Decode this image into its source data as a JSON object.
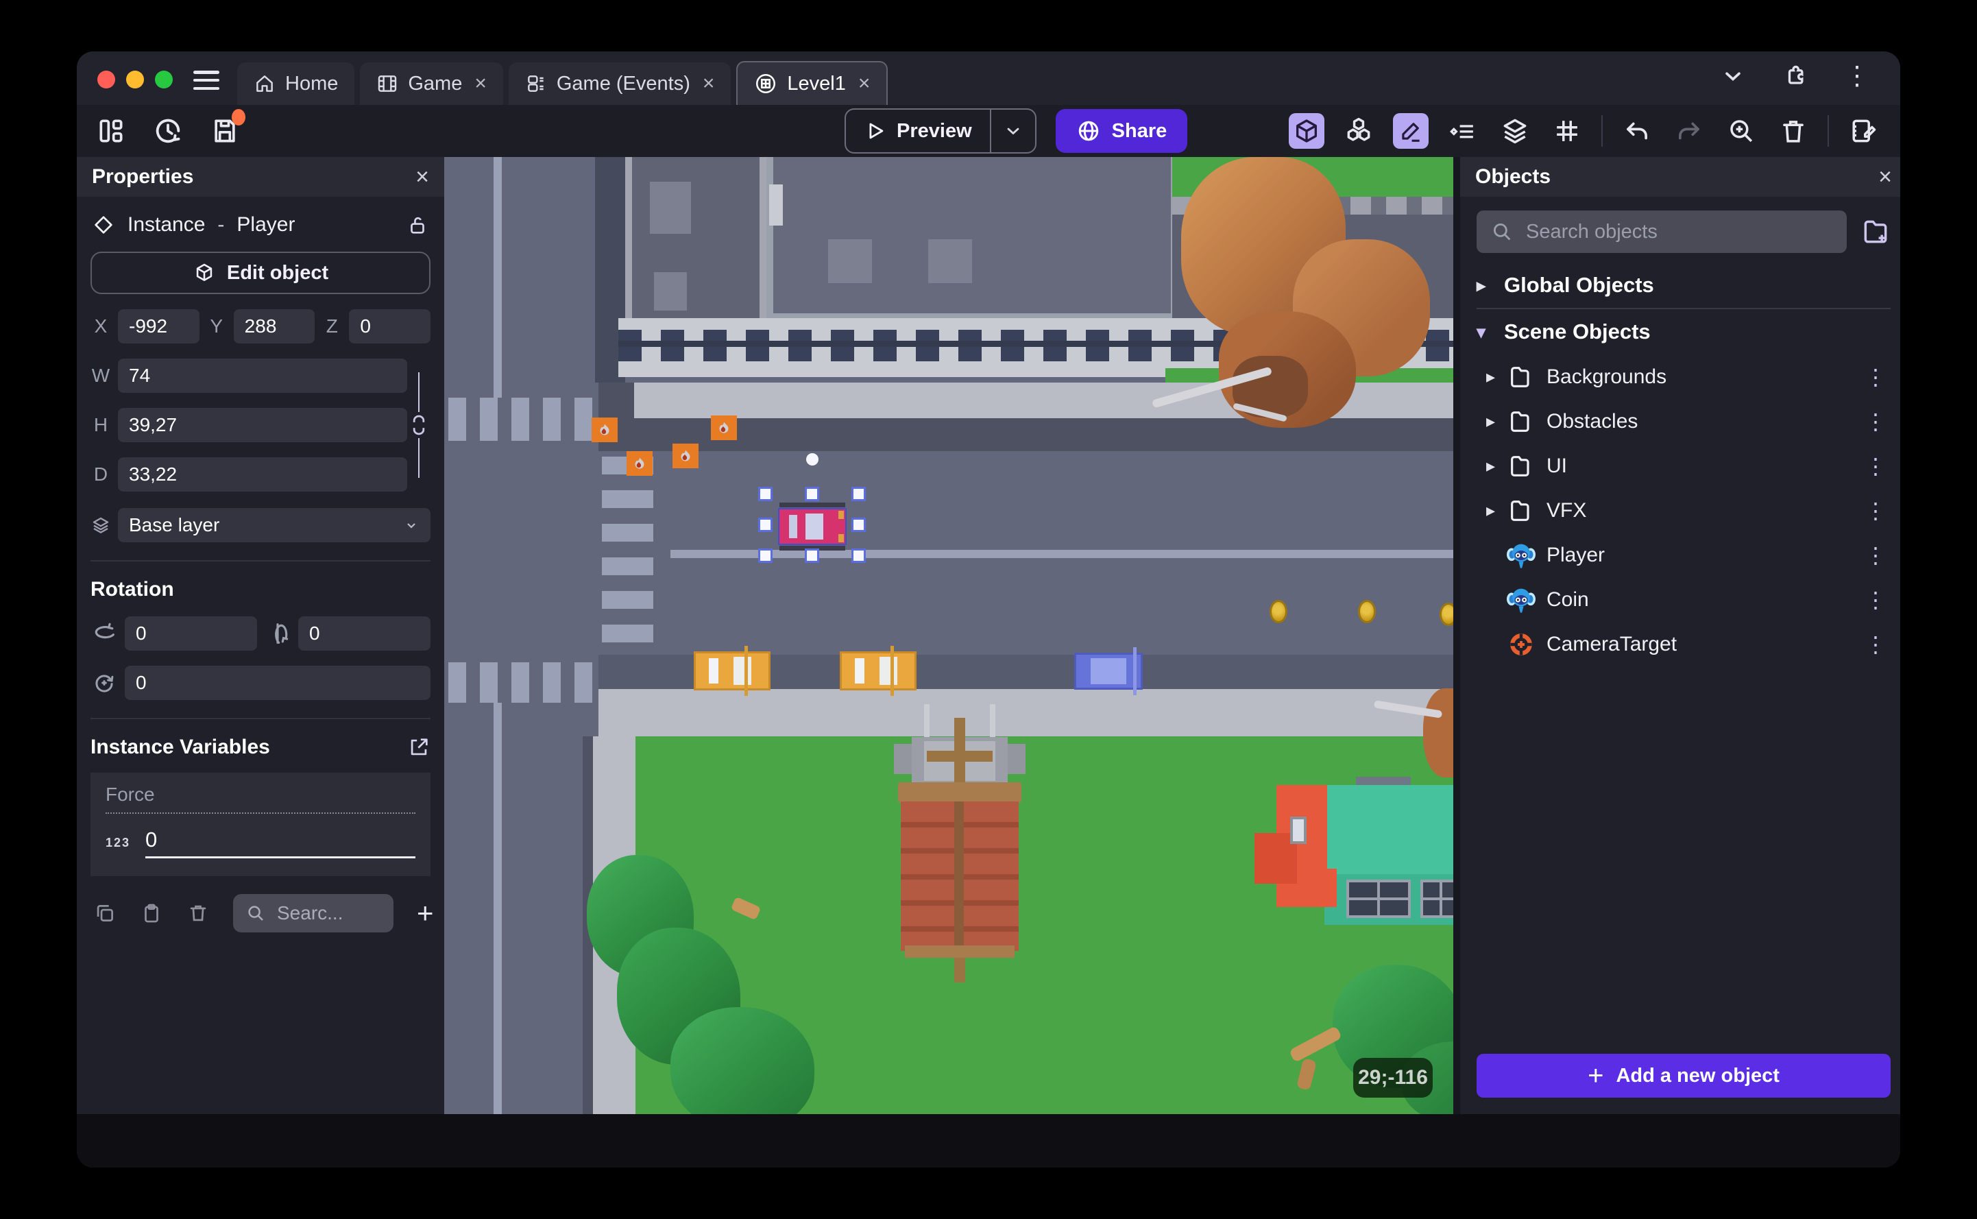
{
  "tabs": {
    "items": [
      {
        "label": "Home"
      },
      {
        "label": "Game"
      },
      {
        "label": "Game (Events)"
      },
      {
        "label": "Level1"
      }
    ],
    "close_glyph": "×"
  },
  "toolbar": {
    "preview": "Preview",
    "share": "Share"
  },
  "properties": {
    "title": "Properties",
    "close_glyph": "×",
    "instance_word": "Instance",
    "dash": "-",
    "object_name": "Player",
    "edit_object": "Edit object",
    "x_label": "X",
    "x_value": "-992",
    "y_label": "Y",
    "y_value": "288",
    "z_label": "Z",
    "z_value": "0",
    "w_label": "W",
    "w_value": "74",
    "h_label": "H",
    "h_value": "39,27",
    "d_label": "D",
    "d_value": "33,22",
    "layer_value": "Base layer",
    "rotation_title": "Rotation",
    "rot_x": "0",
    "rot_y": "0",
    "rot_z": "0",
    "variables_title": "Instance Variables",
    "variable_name": "Force",
    "variable_type": "123",
    "variable_value": "0",
    "search_placeholder": "Searc...",
    "add_glyph": "+"
  },
  "objects": {
    "title": "Objects",
    "close_glyph": "×",
    "search_placeholder": "Search objects",
    "global_group": "Global Objects",
    "scene_group": "Scene Objects",
    "folders": [
      {
        "name": "Backgrounds"
      },
      {
        "name": "Obstacles"
      },
      {
        "name": "UI"
      },
      {
        "name": "VFX"
      }
    ],
    "items": [
      {
        "name": "Player"
      },
      {
        "name": "Coin"
      },
      {
        "name": "CameraTarget"
      }
    ],
    "add_button": "Add a new object",
    "add_glyph": "+",
    "menu_glyph": "⋮",
    "collapsed_glyph": "▸",
    "expanded_glyph": "▾"
  },
  "canvas": {
    "coordinates_badge": "29;-116"
  },
  "colors": {
    "accent_purple": "#5b2ee5",
    "share_purple": "#5227d8",
    "active_tool_bg": "#b7a8f4",
    "selection_blue": "#5b6ee0",
    "grass": "#4aa546",
    "road": "#62677c",
    "sidewalk": "#b9bbc5",
    "save_dot": "#ff7043",
    "traffic_red": "#ff5f57",
    "traffic_yellow": "#febc2e",
    "traffic_green": "#28c840"
  }
}
